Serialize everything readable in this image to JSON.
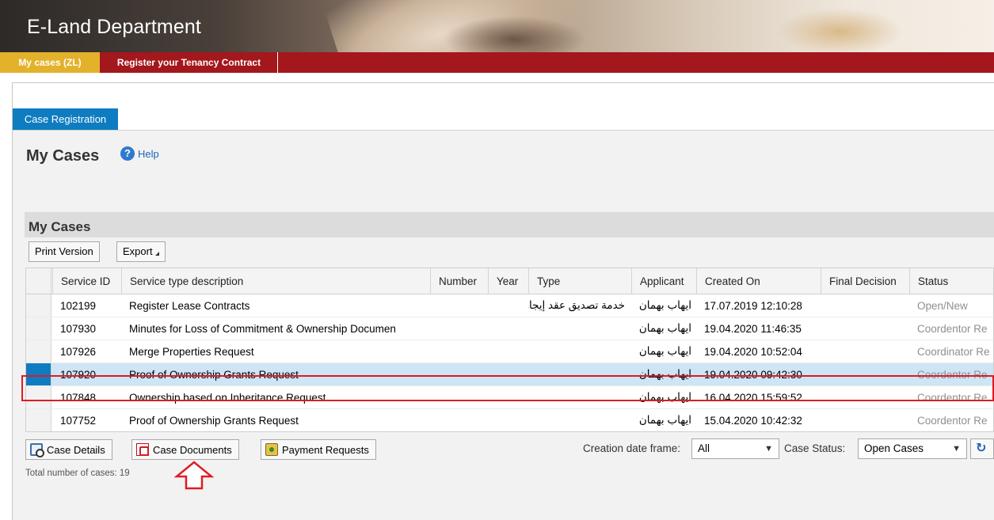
{
  "app": {
    "title": "E-Land Department"
  },
  "nav": {
    "tabs": [
      {
        "label": "My cases (ZL)",
        "active": true
      },
      {
        "label": "Register your Tenancy Contract",
        "active": false
      }
    ]
  },
  "subtab": {
    "label": "Case Registration"
  },
  "page": {
    "title": "My Cases",
    "help_label": "Help",
    "help_icon": "?"
  },
  "section": {
    "title": "My Cases"
  },
  "toolbar": {
    "print_label": "Print Version",
    "export_label": "Export"
  },
  "table": {
    "columns": [
      "Service ID",
      "Service type description",
      "Number",
      "Year",
      "Type",
      "Applicant",
      "Created On",
      "Final Decision",
      "Status"
    ],
    "rows": [
      {
        "service_id": "102199",
        "description": "Register Lease Contracts",
        "number": "",
        "year": "",
        "type": "خدمة تصديق عقد إيجار",
        "applicant": "ايهاب بهمان",
        "created_on": "17.07.2019 12:10:28",
        "final_decision": "",
        "status": "Open/New",
        "selected": false
      },
      {
        "service_id": "107930",
        "description": "Minutes for Loss of Commitment & Ownership Documen",
        "number": "",
        "year": "",
        "type": "",
        "applicant": "ايهاب بهمان",
        "created_on": "19.04.2020 11:46:35",
        "final_decision": "",
        "status": "Coordentor Re",
        "selected": false
      },
      {
        "service_id": "107926",
        "description": "Merge Properties Request",
        "number": "",
        "year": "",
        "type": "",
        "applicant": "ايهاب بهمان",
        "created_on": "19.04.2020 10:52:04",
        "final_decision": "",
        "status": "Coordinator Re",
        "selected": false
      },
      {
        "service_id": "107920",
        "description": "Proof of Ownership Grants Request",
        "number": "",
        "year": "",
        "type": "",
        "applicant": "ايهاب بهمان",
        "created_on": "19.04.2020 09:42:30",
        "final_decision": "",
        "status": "Coordentor Re",
        "selected": true
      },
      {
        "service_id": "107848",
        "description": "Ownership based on Inheritance Request",
        "number": "",
        "year": "",
        "type": "",
        "applicant": "ايهاب بهمان",
        "created_on": "16.04.2020 15:59:52",
        "final_decision": "",
        "status": "Coordentor Re",
        "selected": false
      },
      {
        "service_id": "107752",
        "description": "Proof of Ownership Grants Request",
        "number": "",
        "year": "",
        "type": "",
        "applicant": "ايهاب بهمان",
        "created_on": "15.04.2020 10:42:32",
        "final_decision": "",
        "status": "Coordentor Re",
        "selected": false
      }
    ]
  },
  "actions": {
    "details_label": "Case Details",
    "documents_label": "Case Documents",
    "payment_label": "Payment Requests"
  },
  "filters": {
    "date_label": "Creation date frame:",
    "date_value": "All",
    "status_label": "Case Status:",
    "status_value": "Open Cases",
    "refresh_icon": "refresh-icon"
  },
  "footer": {
    "total_text": "Total number of cases: 19"
  },
  "colors": {
    "brand_red": "#a3171d",
    "active_tab": "#e4b12b",
    "accent_blue": "#0e7cc1",
    "selection": "#cde5f4",
    "highlight": "#e01b23"
  }
}
